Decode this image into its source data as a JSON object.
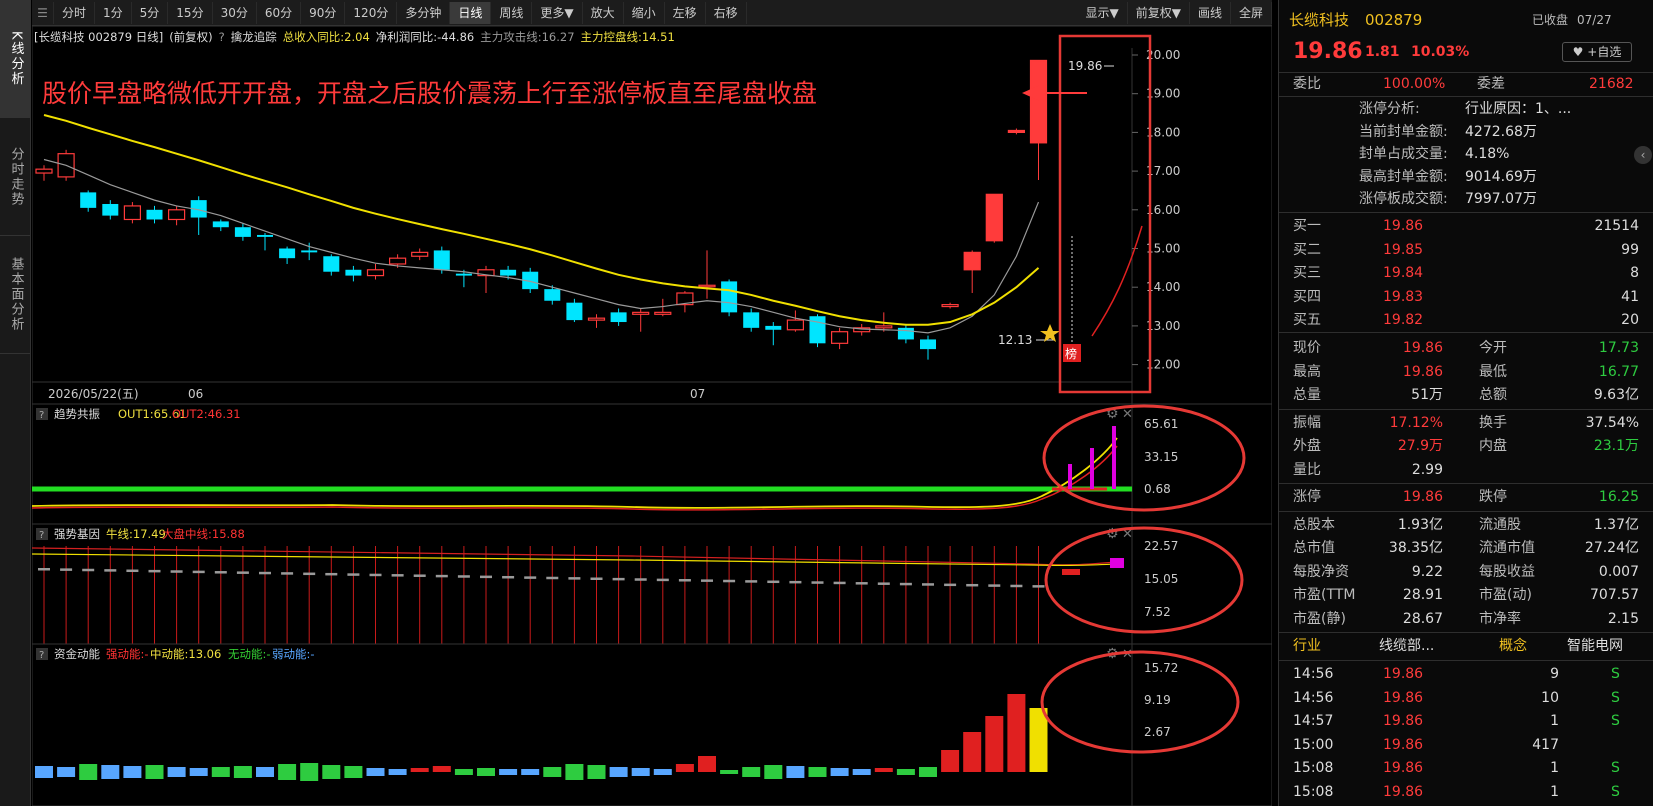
{
  "left_tabs": [
    "K线分析",
    "分时走势",
    "基本面分析"
  ],
  "toolbar": {
    "left": [
      "分时",
      "1分",
      "5分",
      "15分",
      "30分",
      "60分",
      "90分",
      "120分",
      "多分钟",
      "日线",
      "周线",
      "更多▼",
      "放大",
      "缩小",
      "左移",
      "右移"
    ],
    "active": "日线",
    "right": [
      "显示▼",
      "前复权▼",
      "画线",
      "全屏"
    ]
  },
  "info_line": {
    "stock": "[长缆科技 002879 日线]",
    "adj": "(前复权)",
    "indicator": "擒龙追踪",
    "rev_growth": "总收入同比:2.04",
    "profit_growth": "净利润同比:-44.86",
    "attack_line": "主力攻击线:16.27",
    "control_line": "主力控盘线:14.51"
  },
  "annotation_text": "股价早盘略微低开开盘，开盘之后股价震荡上行至涨停板直至尾盘收盘",
  "main_chart": {
    "price_axis": [
      "20.00",
      "19.00",
      "18.00",
      "17.00",
      "16.00",
      "15.00",
      "14.00",
      "13.00",
      "12.00"
    ],
    "high_label": "19.86",
    "low_label": "12.13",
    "date_labels": [
      "2026/05/22(五)",
      "06",
      "07"
    ],
    "badge": "榜"
  },
  "panel1": {
    "name": "趋势共振",
    "out1": "OUT1:65.61",
    "out2": "OUT2:46.31",
    "axis": [
      "65.61",
      "33.15",
      "0.68"
    ]
  },
  "panel2": {
    "name": "强势基因",
    "bull": "牛线:17.49",
    "market": "大盘中线:15.88",
    "axis": [
      "22.57",
      "15.05",
      "7.52"
    ]
  },
  "panel3": {
    "name": "资金动能",
    "strong": "强动能:-",
    "mid": "中动能:13.06",
    "none": "无动能:-",
    "weak": "弱动能:-",
    "axis": [
      "15.72",
      "9.19",
      "2.67"
    ]
  },
  "quote": {
    "name": "长缆科技",
    "code": "002879",
    "status": "已收盘",
    "date": "07/27",
    "watch": "+自选",
    "price": "19.86",
    "change": "1.81",
    "pct": "10.03%",
    "weibi_label": "委比",
    "weibi": "100.00%",
    "weicha_label": "委差",
    "weicha": "21682",
    "limit": [
      {
        "label": "涨停分析:",
        "value": "行业原因：1、..."
      },
      {
        "label": "当前封单金额:",
        "value": "4272.68万"
      },
      {
        "label": "封单占成交量:",
        "value": "4.18%"
      },
      {
        "label": "最高封单金额:",
        "value": "9014.69万"
      },
      {
        "label": "涨停板成交额:",
        "value": "7997.07万"
      }
    ],
    "bids": [
      {
        "label": "买一",
        "price": "19.86",
        "vol": "21514"
      },
      {
        "label": "买二",
        "price": "19.85",
        "vol": "99"
      },
      {
        "label": "买三",
        "price": "19.84",
        "vol": "8"
      },
      {
        "label": "买四",
        "price": "19.83",
        "vol": "41"
      },
      {
        "label": "买五",
        "price": "19.82",
        "vol": "20"
      }
    ],
    "stats1": [
      {
        "l1": "现价",
        "v1": "19.86",
        "c1": "r",
        "l2": "今开",
        "v2": "17.73",
        "c2": "g"
      },
      {
        "l1": "最高",
        "v1": "19.86",
        "c1": "r",
        "l2": "最低",
        "v2": "16.77",
        "c2": "g"
      },
      {
        "l1": "总量",
        "v1": "51万",
        "c1": "w",
        "l2": "总额",
        "v2": "9.63亿",
        "c2": "w"
      }
    ],
    "stats2": [
      {
        "l1": "振幅",
        "v1": "17.12%",
        "c1": "r",
        "l2": "换手",
        "v2": "37.54%",
        "c2": "w"
      },
      {
        "l1": "外盘",
        "v1": "27.9万",
        "c1": "r",
        "l2": "内盘",
        "v2": "23.1万",
        "c2": "g"
      },
      {
        "l1": "量比",
        "v1": "2.99",
        "c1": "w",
        "l2": "",
        "v2": "",
        "c2": "w"
      }
    ],
    "stats3": [
      {
        "l1": "涨停",
        "v1": "19.86",
        "c1": "r",
        "l2": "跌停",
        "v2": "16.25",
        "c2": "g"
      }
    ],
    "stats4": [
      {
        "l1": "总股本",
        "v1": "1.93亿",
        "c1": "w",
        "l2": "流通股",
        "v2": "1.37亿",
        "c2": "w"
      },
      {
        "l1": "总市值",
        "v1": "38.35亿",
        "c1": "w",
        "l2": "流通市值",
        "v2": "27.24亿",
        "c2": "w"
      },
      {
        "l1": "每股净资",
        "v1": "9.22",
        "c1": "w",
        "l2": "每股收益",
        "v2": "0.007",
        "c2": "w"
      },
      {
        "l1": "市盈(TTM",
        "v1": "28.91",
        "c1": "w",
        "l2": "市盈(动)",
        "v2": "707.57",
        "c2": "w"
      },
      {
        "l1": "市盈(静)",
        "v1": "28.67",
        "c1": "w",
        "l2": "市净率",
        "v2": "2.15",
        "c2": "w"
      }
    ],
    "industry": {
      "l1": "行业",
      "v1": "线缆部...",
      "l2": "概念",
      "v2": "智能电网"
    },
    "ticks": [
      {
        "time": "14:56",
        "price": "19.86",
        "vol": "9",
        "side": "S"
      },
      {
        "time": "14:56",
        "price": "19.86",
        "vol": "10",
        "side": "S"
      },
      {
        "time": "14:57",
        "price": "19.86",
        "vol": "1",
        "side": "S"
      },
      {
        "time": "15:00",
        "price": "19.86",
        "vol": "417",
        "side": ""
      },
      {
        "time": "15:08",
        "price": "19.86",
        "vol": "1",
        "side": "S"
      },
      {
        "time": "15:08",
        "price": "19.86",
        "vol": "1",
        "side": "S"
      }
    ]
  },
  "chart_data": {
    "type": "candlestick",
    "candles": [
      [
        16.95,
        17.05,
        16.75,
        17.15
      ],
      [
        16.85,
        17.45,
        16.75,
        17.55
      ],
      [
        16.45,
        16.05,
        15.95,
        16.5
      ],
      [
        16.15,
        15.85,
        15.75,
        16.25
      ],
      [
        15.75,
        16.1,
        15.65,
        16.2
      ],
      [
        16.0,
        15.75,
        15.65,
        16.1
      ],
      [
        15.75,
        16.0,
        15.6,
        16.1
      ],
      [
        16.25,
        15.8,
        15.35,
        16.35
      ],
      [
        15.7,
        15.55,
        15.45,
        15.75
      ],
      [
        15.55,
        15.3,
        15.2,
        15.65
      ],
      [
        15.35,
        15.3,
        14.95,
        15.4
      ],
      [
        15.0,
        14.75,
        14.6,
        15.05
      ],
      [
        14.95,
        14.9,
        14.7,
        15.15
      ],
      [
        14.8,
        14.4,
        14.3,
        14.85
      ],
      [
        14.45,
        14.3,
        14.15,
        14.55
      ],
      [
        14.3,
        14.45,
        14.2,
        14.6
      ],
      [
        14.6,
        14.75,
        14.5,
        14.85
      ],
      [
        14.8,
        14.9,
        14.7,
        15.0
      ],
      [
        14.95,
        14.45,
        14.35,
        15.05
      ],
      [
        14.35,
        14.3,
        14.0,
        14.45
      ],
      [
        14.3,
        14.45,
        13.85,
        14.55
      ],
      [
        14.45,
        14.3,
        14.2,
        14.55
      ],
      [
        14.4,
        13.95,
        13.85,
        14.5
      ],
      [
        13.95,
        13.65,
        13.55,
        14.05
      ],
      [
        13.6,
        13.15,
        13.1,
        13.7
      ],
      [
        13.15,
        13.2,
        12.95,
        13.3
      ],
      [
        13.35,
        13.1,
        13.0,
        13.45
      ],
      [
        13.3,
        13.35,
        12.85,
        13.45
      ],
      [
        13.3,
        13.35,
        13.25,
        13.7
      ],
      [
        13.55,
        13.85,
        13.35,
        13.9
      ],
      [
        14.05,
        14.05,
        13.7,
        14.95
      ],
      [
        14.15,
        13.35,
        13.25,
        14.2
      ],
      [
        13.35,
        12.95,
        12.85,
        13.45
      ],
      [
        13.0,
        12.9,
        12.5,
        13.1
      ],
      [
        12.9,
        13.15,
        12.85,
        13.4
      ],
      [
        13.25,
        12.55,
        12.45,
        13.3
      ],
      [
        12.55,
        12.85,
        12.4,
        12.95
      ],
      [
        12.85,
        12.95,
        12.75,
        13.05
      ],
      [
        12.95,
        13.0,
        12.85,
        13.35
      ],
      [
        12.95,
        12.65,
        12.55,
        13.05
      ],
      [
        12.65,
        12.4,
        12.13,
        12.75
      ],
      [
        13.5,
        13.55,
        13.45,
        13.6
      ],
      [
        14.45,
        14.9,
        13.85,
        14.95
      ],
      [
        15.2,
        16.4,
        15.15,
        16.4
      ],
      [
        18.0,
        18.05,
        17.95,
        18.1
      ],
      [
        17.73,
        19.86,
        16.77,
        19.86
      ]
    ],
    "ma_yellow": [
      18.45,
      18.3,
      18.12,
      17.95,
      17.78,
      17.62,
      17.45,
      17.28,
      17.1,
      16.92,
      16.75,
      16.58,
      16.4,
      16.23,
      16.05,
      15.9,
      15.76,
      15.63,
      15.5,
      15.38,
      15.25,
      15.12,
      14.98,
      14.82,
      14.65,
      14.48,
      14.32,
      14.2,
      14.1,
      14.02,
      13.97,
      13.92,
      13.8,
      13.65,
      13.52,
      13.38,
      13.25,
      13.15,
      13.08,
      13.03,
      13.03,
      13.1,
      13.3,
      13.6,
      14.0,
      14.5
    ],
    "ma_gray": [
      17.3,
      17.15,
      16.9,
      16.65,
      16.45,
      16.25,
      16.1,
      16.0,
      15.85,
      15.65,
      15.45,
      15.25,
      15.05,
      14.9,
      14.75,
      14.62,
      14.55,
      14.5,
      14.45,
      14.4,
      14.32,
      14.25,
      14.15,
      14.0,
      13.85,
      13.7,
      13.55,
      13.45,
      13.5,
      13.58,
      13.65,
      13.6,
      13.5,
      13.35,
      13.2,
      13.1,
      12.98,
      12.92,
      12.9,
      12.88,
      12.82,
      12.95,
      13.25,
      13.8,
      14.8,
      16.2
    ]
  }
}
